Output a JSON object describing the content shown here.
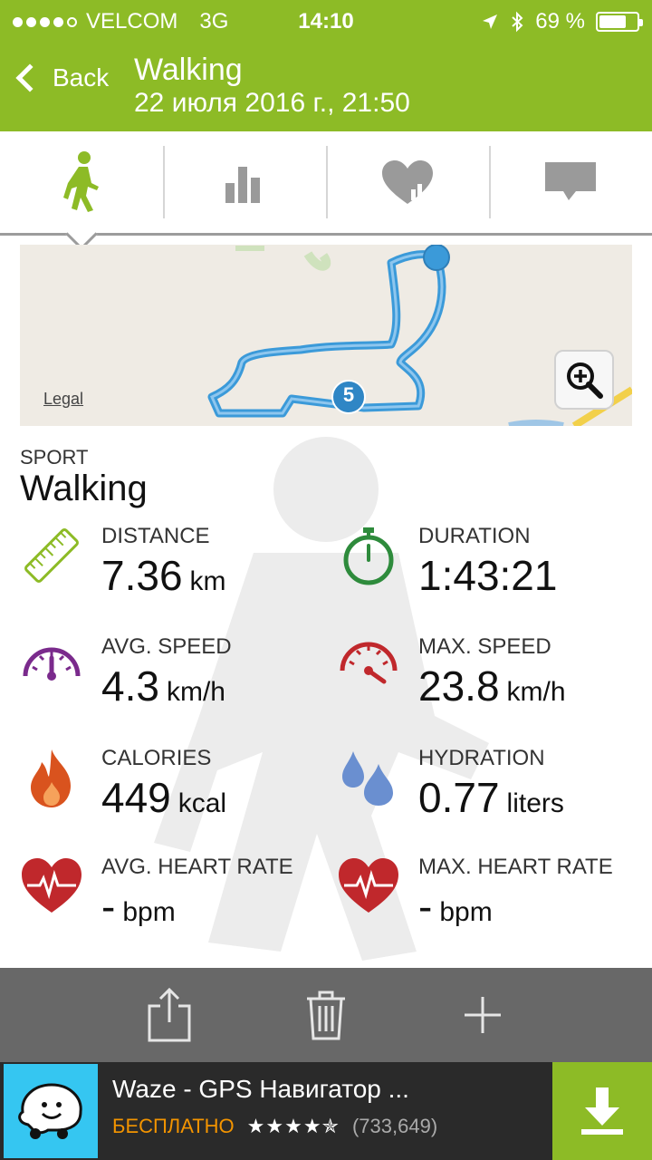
{
  "status_bar": {
    "carrier": "VELCOM",
    "network": "3G",
    "time": "14:10",
    "battery": "69 %",
    "battery_level": 0.69
  },
  "nav": {
    "back_label": "Back",
    "title": "Walking",
    "subtitle": "22 июля 2016 г., 21:50"
  },
  "tabs": [
    {
      "name": "walker-icon",
      "active": true
    },
    {
      "name": "bar-chart-icon",
      "active": false
    },
    {
      "name": "heart-chart-icon",
      "active": false
    },
    {
      "name": "comment-icon",
      "active": false
    }
  ],
  "map": {
    "legal": "Legal",
    "marker_label": "5"
  },
  "sport": {
    "label": "SPORT",
    "value": "Walking"
  },
  "stats": {
    "distance": {
      "label": "DISTANCE",
      "value": "7.36",
      "unit": "km",
      "icon": "ruler-icon"
    },
    "duration": {
      "label": "DURATION",
      "value": "1:43:21",
      "unit": "",
      "icon": "stopwatch-icon"
    },
    "avg_speed": {
      "label": "AVG. SPEED",
      "value": "4.3",
      "unit": "km/h",
      "icon": "speedometer-icon"
    },
    "max_speed": {
      "label": "MAX. SPEED",
      "value": "23.8",
      "unit": "km/h",
      "icon": "speedometer-icon"
    },
    "calories": {
      "label": "CALORIES",
      "value": "449",
      "unit": "kcal",
      "icon": "flame-icon"
    },
    "hydration": {
      "label": "HYDRATION",
      "value": "0.77",
      "unit": "liters",
      "icon": "drops-icon"
    },
    "avg_hr": {
      "label": "AVG. HEART RATE",
      "value": "-",
      "unit": "bpm",
      "icon": "heart-pulse-icon"
    },
    "max_hr": {
      "label": "MAX. HEART RATE",
      "value": "-",
      "unit": "bpm",
      "icon": "heart-pulse-icon"
    }
  },
  "toolbar": {
    "items": [
      "share-icon",
      "trash-icon",
      "plus-icon"
    ]
  },
  "ad": {
    "title": "Waze - GPS Навигатор ...",
    "price": "БЕСПЛАТНО",
    "stars": "★★★★✯",
    "count": "(733,649)"
  },
  "colors": {
    "brand_green": "#8dbb26",
    "route_blue": "#3b9ad9",
    "toolbar_gray": "#686868"
  }
}
